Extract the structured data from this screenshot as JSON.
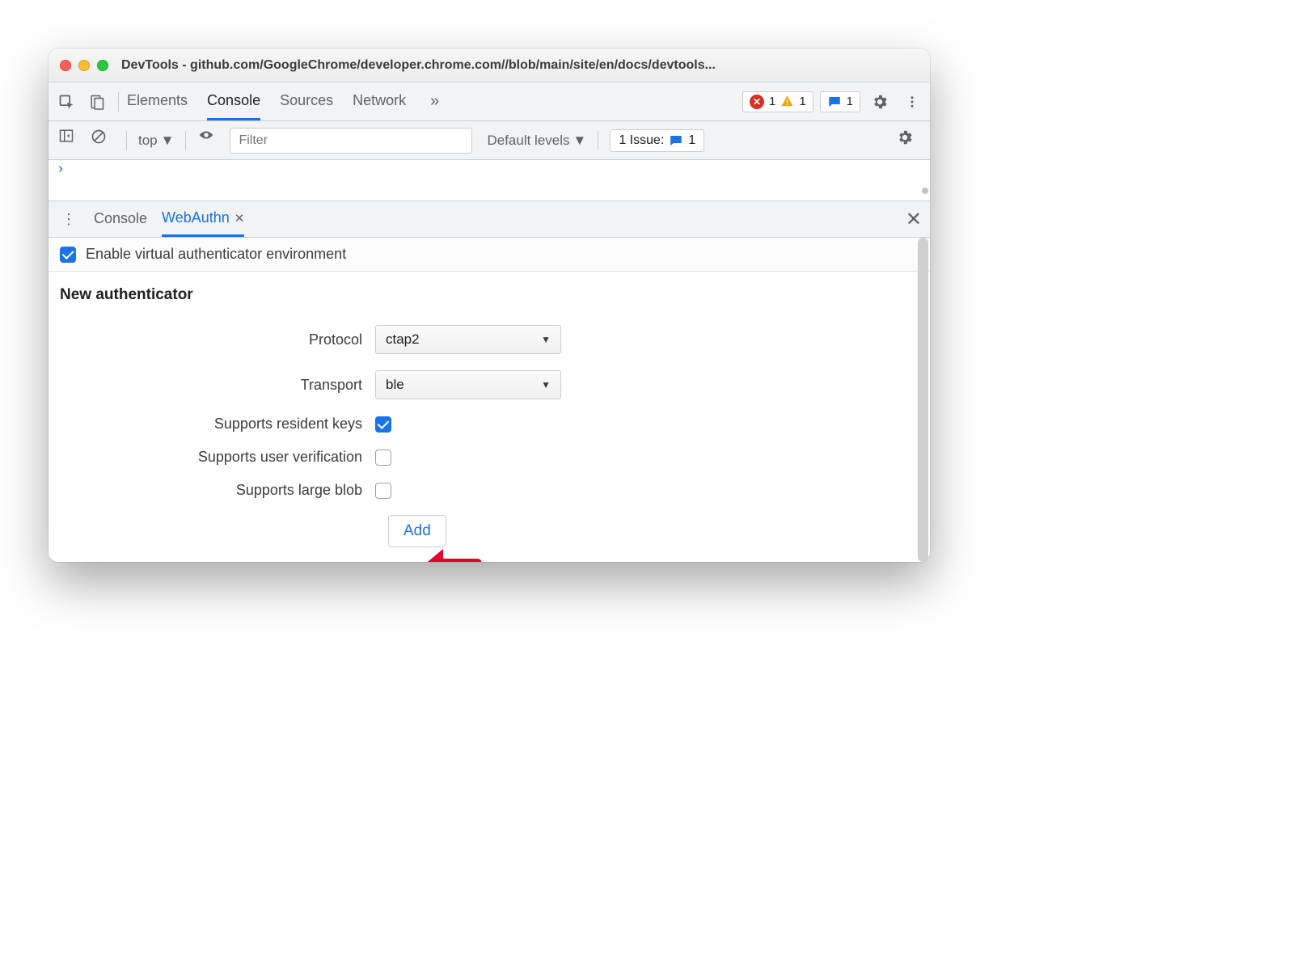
{
  "window": {
    "title": "DevTools - github.com/GoogleChrome/developer.chrome.com//blob/main/site/en/docs/devtools..."
  },
  "main_tabs": {
    "items": [
      "Elements",
      "Console",
      "Sources",
      "Network"
    ],
    "active": "Console"
  },
  "status_badges": {
    "errors": "1",
    "warnings": "1",
    "issues": "1"
  },
  "console_bar": {
    "context": "top",
    "filter_placeholder": "Filter",
    "levels_label": "Default levels",
    "issues_label": "1 Issue:",
    "issues_count": "1"
  },
  "drawer_tabs": {
    "items": [
      "Console",
      "WebAuthn"
    ],
    "active": "WebAuthn"
  },
  "webauthn": {
    "enable_label": "Enable virtual authenticator environment",
    "enabled": true,
    "section_title": "New authenticator",
    "fields": {
      "protocol": {
        "label": "Protocol",
        "value": "ctap2"
      },
      "transport": {
        "label": "Transport",
        "value": "ble"
      },
      "resident_keys": {
        "label": "Supports resident keys",
        "checked": true
      },
      "user_verification": {
        "label": "Supports user verification",
        "checked": false
      },
      "large_blob": {
        "label": "Supports large blob",
        "checked": false
      }
    },
    "add_button": "Add"
  }
}
